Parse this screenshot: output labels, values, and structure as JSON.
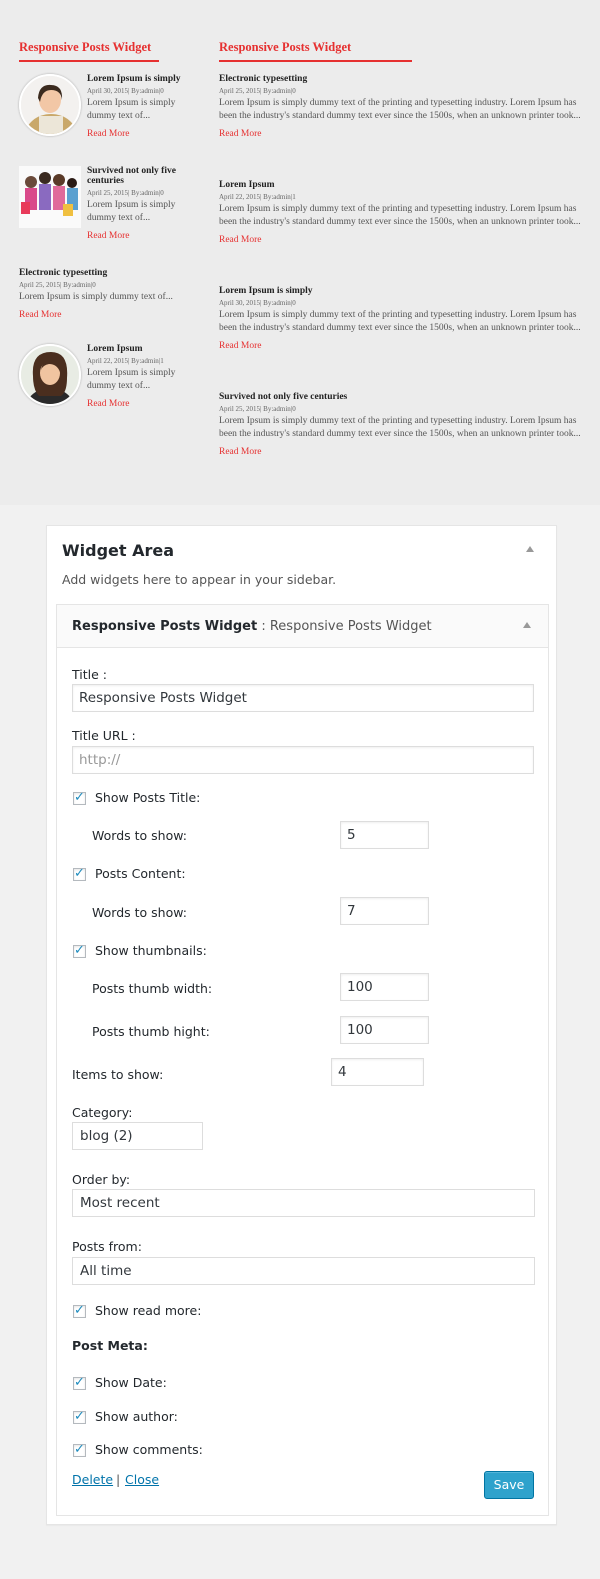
{
  "preview": {
    "left": {
      "title": "Responsive Posts Widget",
      "posts": [
        {
          "title": "Lorem Ipsum is simply",
          "meta": "April 30, 2015| By:admin|0",
          "content": "Lorem Ipsum is simply dummy text of...",
          "more": "Read More",
          "thumb": "woman-portrait-thumbnail"
        },
        {
          "title": "Survived not only five centuries",
          "meta": "April 25, 2015| By:admin|0",
          "content": "Lorem Ipsum is simply dummy text of...",
          "more": "Read More",
          "thumb": "shopping-girls-thumbnail"
        },
        {
          "title": "Electronic typesetting",
          "meta": "April 25, 2015| By:admin|0",
          "content": "Lorem Ipsum is simply dummy text of...",
          "more": "Read More"
        },
        {
          "title": "Lorem Ipsum",
          "meta": "April 22, 2015| By:admin|1",
          "content": "Lorem Ipsum is simply dummy text of...",
          "more": "Read More",
          "thumb": "brunette-portrait-thumbnail"
        }
      ]
    },
    "right": {
      "title": "Responsive Posts Widget",
      "posts": [
        {
          "title": "Electronic typesetting",
          "meta": "April 25, 2015| By:admin|0",
          "content": "Lorem Ipsum is simply dummy text of the printing and typesetting industry. Lorem Ipsum has been the industry's standard dummy text ever since the 1500s, when an unknown printer took...",
          "more": "Read More"
        },
        {
          "title": "Lorem Ipsum",
          "meta": "April 22, 2015| By:admin|1",
          "content": "Lorem Ipsum is simply dummy text of the printing and typesetting industry. Lorem Ipsum has been the industry's standard dummy text ever since the 1500s, when an unknown printer took...",
          "more": "Read More"
        },
        {
          "title": "Lorem Ipsum is simply",
          "meta": "April 30, 2015| By:admin|0",
          "content": "Lorem Ipsum is simply dummy text of the printing and typesetting industry. Lorem Ipsum has been the industry's standard dummy text ever since the 1500s, when an unknown printer took...",
          "more": "Read More"
        },
        {
          "title": "Survived not only five centuries",
          "meta": "April 25, 2015| By:admin|0",
          "content": "Lorem Ipsum is simply dummy text of the printing and typesetting industry. Lorem Ipsum has been the industry's standard dummy text ever since the 1500s, when an unknown printer took...",
          "more": "Read More"
        }
      ]
    },
    "accent_color": "#e63030"
  },
  "panel": {
    "title": "Widget Area",
    "description": "Add widgets here to appear in your sidebar.",
    "widget": {
      "name": "Responsive Posts Widget",
      "separator": ":",
      "instance_title": "Responsive Posts Widget",
      "fields": {
        "title_label": "Title :",
        "title_value": "Responsive Posts Widget",
        "title_url_label": "Title URL :",
        "title_url_placeholder": "http://",
        "show_posts_title_label": "Show Posts Title:",
        "show_posts_title_checked": true,
        "title_words_label": "Words to show:",
        "title_words_value": "5",
        "posts_content_label": "Posts Content:",
        "posts_content_checked": true,
        "content_words_label": "Words to show:",
        "content_words_value": "7",
        "show_thumbnails_label": "Show thumbnails:",
        "show_thumbnails_checked": true,
        "thumb_width_label": "Posts thumb width:",
        "thumb_width_value": "100",
        "thumb_height_label": "Posts thumb hight:",
        "thumb_height_value": "100",
        "items_label": "Items to show:",
        "items_value": "4",
        "category_label": "Category:",
        "category_value": "blog  (2)",
        "order_label": "Order by:",
        "order_value": "Most recent",
        "posts_from_label": "Posts from:",
        "posts_from_value": "All time",
        "show_read_more_label": "Show read more:",
        "show_read_more_checked": true,
        "post_meta_heading": "Post Meta:",
        "show_date_label": "Show Date:",
        "show_date_checked": true,
        "show_author_label": "Show author:",
        "show_author_checked": true,
        "show_comments_label": "Show comments:",
        "show_comments_checked": true
      },
      "footer": {
        "delete_label": "Delete",
        "divider": "|",
        "close_label": "Close",
        "save_label": "Save"
      }
    }
  },
  "colors": {
    "link": "#0073aa",
    "button": "#2ea2cc",
    "check": "#1e8cbe"
  }
}
